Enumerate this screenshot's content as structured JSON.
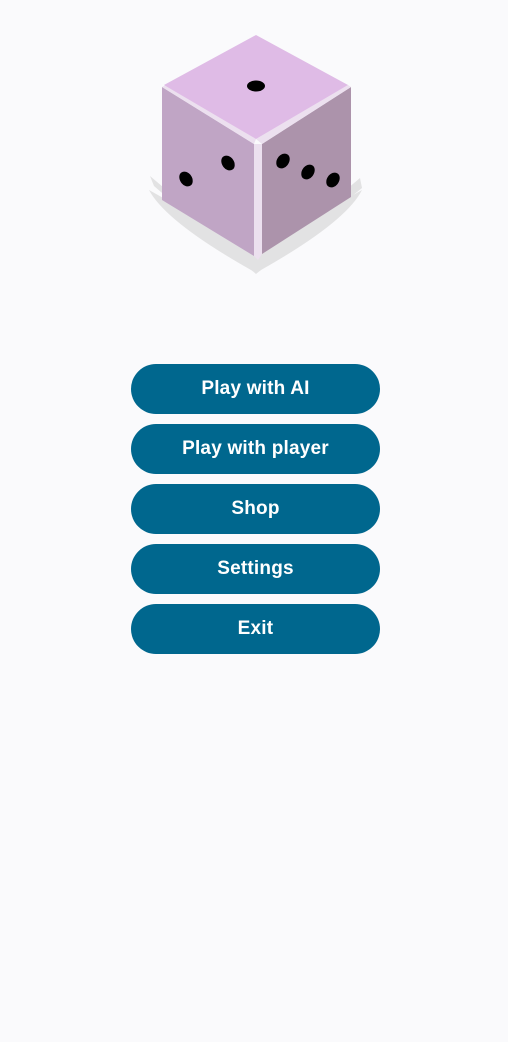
{
  "logo": {
    "icon": "dice-icon",
    "colors": {
      "top": "#dfbbe6",
      "left": "#c0a5c5",
      "right": "#ac93ab",
      "edge": "#ece0ef",
      "shadow": "#e2e2e3",
      "pip": "#000000"
    }
  },
  "menu": {
    "accent": "#00678e",
    "text_color": "#ffffff",
    "buttons": [
      {
        "label": "Play with AI"
      },
      {
        "label": "Play with player"
      },
      {
        "label": "Shop"
      },
      {
        "label": "Settings"
      },
      {
        "label": "Exit"
      }
    ]
  }
}
